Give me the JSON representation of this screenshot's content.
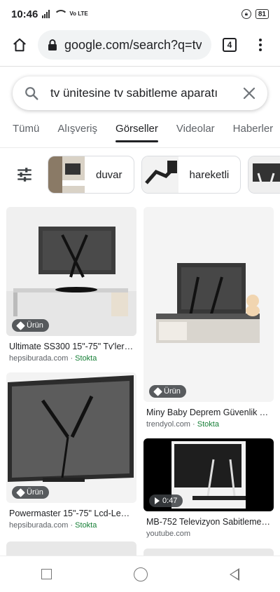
{
  "status": {
    "time": "10:46",
    "volte": "Vo LTE",
    "battery": "81"
  },
  "browser": {
    "url": "google.com/search?q=tv",
    "tab_count": "4"
  },
  "search": {
    "query": "tv ünitesine tv sabitleme aparatı"
  },
  "tabs": [
    {
      "label": "Tümü",
      "active": false
    },
    {
      "label": "Alışveriş",
      "active": false
    },
    {
      "label": "Görseller",
      "active": true
    },
    {
      "label": "Videolar",
      "active": false
    },
    {
      "label": "Haberler",
      "active": false
    }
  ],
  "filters": [
    {
      "label": "duvar"
    },
    {
      "label": "hareketli"
    },
    {
      "label": ""
    }
  ],
  "results_left": [
    {
      "title": "Ultimate SS300 15\"-75\" Tv'ler ...",
      "source": "hepsiburada.com",
      "stock": "Stokta",
      "badge": "Ürün"
    },
    {
      "title": "Powermaster 15\"-75\" Lcd-Led ...",
      "source": "hepsiburada.com",
      "stock": "Stokta",
      "badge": "Ürün"
    }
  ],
  "results_right": [
    {
      "title": "Miny Baby Deprem Güvenlik T...",
      "source": "trendyol.com",
      "stock": "Stokta",
      "badge": "Ürün"
    },
    {
      "title": "MB-752 Televizyon Sabitleme ...",
      "source": "youtube.com",
      "stock": "",
      "badge": "0:47"
    }
  ],
  "colors": {
    "stock": "#188038",
    "accent": "#202124"
  }
}
